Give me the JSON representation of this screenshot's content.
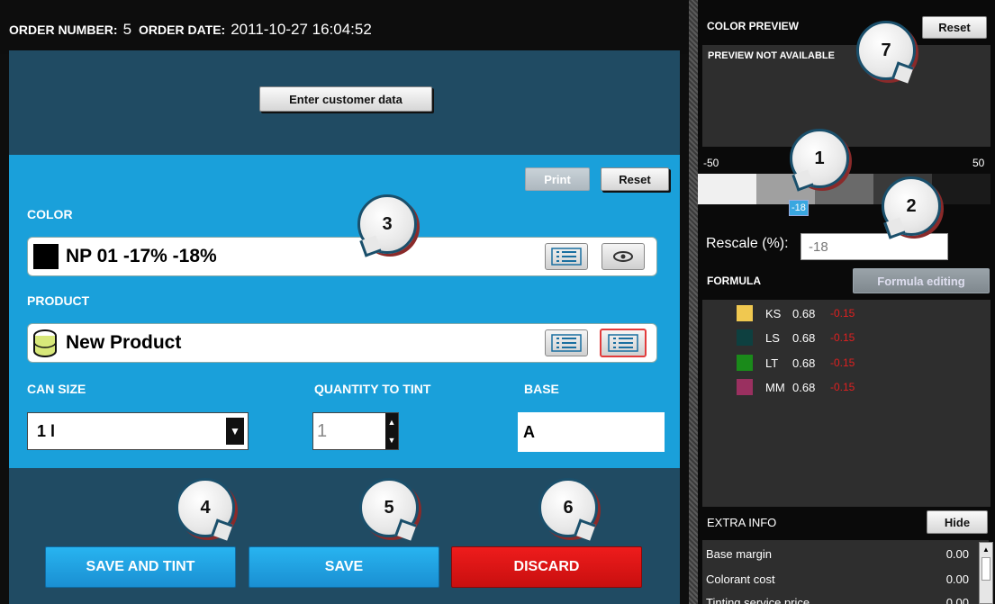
{
  "order": {
    "number_label": "ORDER NUMBER:",
    "number_value": "5",
    "date_label": "ORDER DATE:",
    "date_value": "2011-10-27 16:04:52"
  },
  "buttons": {
    "enter_customer": "Enter customer data",
    "print": "Print",
    "reset": "Reset",
    "save_and_tint": "SAVE AND TINT",
    "save": "SAVE",
    "discard": "DISCARD",
    "preview_reset": "Reset",
    "formula_editing": "Formula editing",
    "hide": "Hide"
  },
  "form": {
    "color_label": "COLOR",
    "color_value": "NP 01 -17% -18%",
    "product_label": "PRODUCT",
    "product_value": "New Product",
    "can_size_label": "CAN SIZE",
    "can_size_value": "1 l",
    "quantity_label": "QUANTITY TO TINT",
    "quantity_value": "1",
    "base_label": "BASE",
    "base_value": "A"
  },
  "callouts": [
    "1",
    "2",
    "3",
    "4",
    "5",
    "6",
    "7"
  ],
  "preview": {
    "title": "COLOR PREVIEW",
    "not_available": "PREVIEW NOT AVAILABLE",
    "scale_min": "-50",
    "scale_max": "50",
    "marker_value": "-18",
    "rescale_label": "Rescale (%):",
    "rescale_value": "-18"
  },
  "formula": {
    "title": "FORMULA",
    "items": [
      {
        "code": "KS",
        "value": "0.68",
        "delta": "-0.15",
        "color": "#f0c850"
      },
      {
        "code": "LS",
        "value": "0.68",
        "delta": "-0.15",
        "color": "#0e4040"
      },
      {
        "code": "LT",
        "value": "0.68",
        "delta": "-0.15",
        "color": "#1a8a1a"
      },
      {
        "code": "MM",
        "value": "0.68",
        "delta": "-0.15",
        "color": "#9a3060"
      }
    ]
  },
  "extra_info": {
    "title": "EXTRA INFO",
    "rows": [
      {
        "label": "Base margin",
        "value": "0.00"
      },
      {
        "label": "Colorant cost",
        "value": "0.00"
      },
      {
        "label": "Tinting service price",
        "value": "0.00"
      }
    ]
  }
}
